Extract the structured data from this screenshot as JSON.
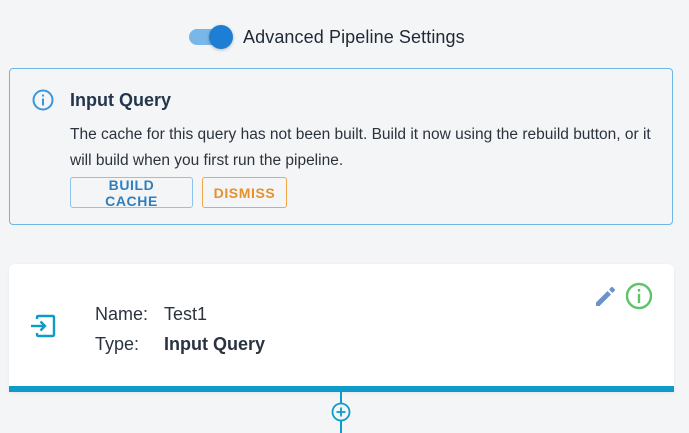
{
  "header": {
    "toggle_label": "Advanced Pipeline Settings",
    "toggle_on": true
  },
  "alert": {
    "icon": "info-icon",
    "title": "Input Query",
    "message": "The cache for this query has not been built. Build it now using the rebuild button, or it will build when you first run the pipeline.",
    "build_label": "BUILD CACHE",
    "dismiss_label": "DISMISS"
  },
  "node": {
    "icon": "input-arrow-icon",
    "name_key": "Name:",
    "name_value": "Test1",
    "type_key": "Type:",
    "type_value": "Input Query",
    "edit_icon": "pencil-icon",
    "info_icon": "info-icon"
  },
  "connector": {
    "add_icon": "plus-circle-icon"
  },
  "colors": {
    "accent": "#1c7fd4",
    "node_bar": "#0e9bc9",
    "info_green": "#5cc46a",
    "dismiss_orange": "#e8902a"
  }
}
